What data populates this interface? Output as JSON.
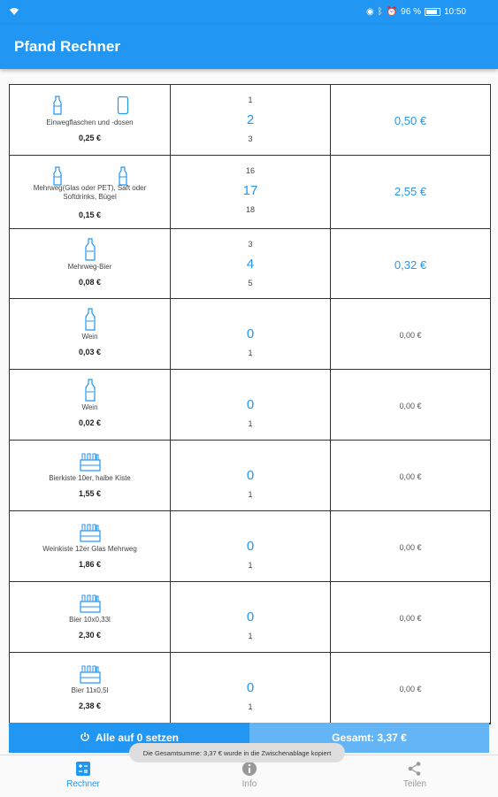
{
  "status": {
    "battery": "96 %",
    "time": "10:50"
  },
  "app": {
    "title": "Pfand Rechner"
  },
  "rows": [
    {
      "label": "Einwegflaschen und -dosen",
      "price": "0,25 €",
      "prev": "1",
      "count": "2",
      "next": "3",
      "amount": "0,50 €",
      "icon": "bottle-and-can-icon"
    },
    {
      "label": "Mehrweg(Glas oder PET), Saft oder Softdrinks, Bügel",
      "price": "0,15 €",
      "prev": "16",
      "count": "17",
      "next": "18",
      "amount": "2,55 €",
      "icon": "bottles-icon"
    },
    {
      "label": "Mehrweg-Bier",
      "price": "0,08 €",
      "prev": "3",
      "count": "4",
      "next": "5",
      "amount": "0,32 €",
      "icon": "beer-bottle-icon"
    },
    {
      "label": "Wein",
      "price": "0,03 €",
      "prev": "",
      "count": "0",
      "next": "1",
      "amount": "0,00 €",
      "icon": "wine-bottle-icon"
    },
    {
      "label": "Wein",
      "price": "0,02 €",
      "prev": "",
      "count": "0",
      "next": "1",
      "amount": "0,00 €",
      "icon": "wine-bottle-icon"
    },
    {
      "label": "Bierkiste 10er, halbe Kiste",
      "price": "1,55 €",
      "prev": "",
      "count": "0",
      "next": "1",
      "amount": "0,00 €",
      "icon": "crate-icon"
    },
    {
      "label": "Weinkiste 12er Glas Mehrweg",
      "price": "1,86 €",
      "prev": "",
      "count": "0",
      "next": "1",
      "amount": "0,00 €",
      "icon": "crate-icon"
    },
    {
      "label": "Bier 10x0,33l",
      "price": "2,30 €",
      "prev": "",
      "count": "0",
      "next": "1",
      "amount": "0,00 €",
      "icon": "crate-icon"
    },
    {
      "label": "Bier 11x0,5l",
      "price": "2,38 €",
      "prev": "",
      "count": "0",
      "next": "1",
      "amount": "0,00 €",
      "icon": "crate-icon"
    }
  ],
  "actions": {
    "reset_label": "Alle auf 0 setzen",
    "total_label": "Gesamt: 3,37 €"
  },
  "toast": {
    "text": "Die Gesamtsumme: 3,37 € wurde in die Zwischenablage kopiert"
  },
  "nav": {
    "rechner": "Rechner",
    "info": "Info",
    "teilen": "Teilen"
  },
  "colors": {
    "primary": "#2196f3",
    "primary_light": "#64b5f6"
  }
}
